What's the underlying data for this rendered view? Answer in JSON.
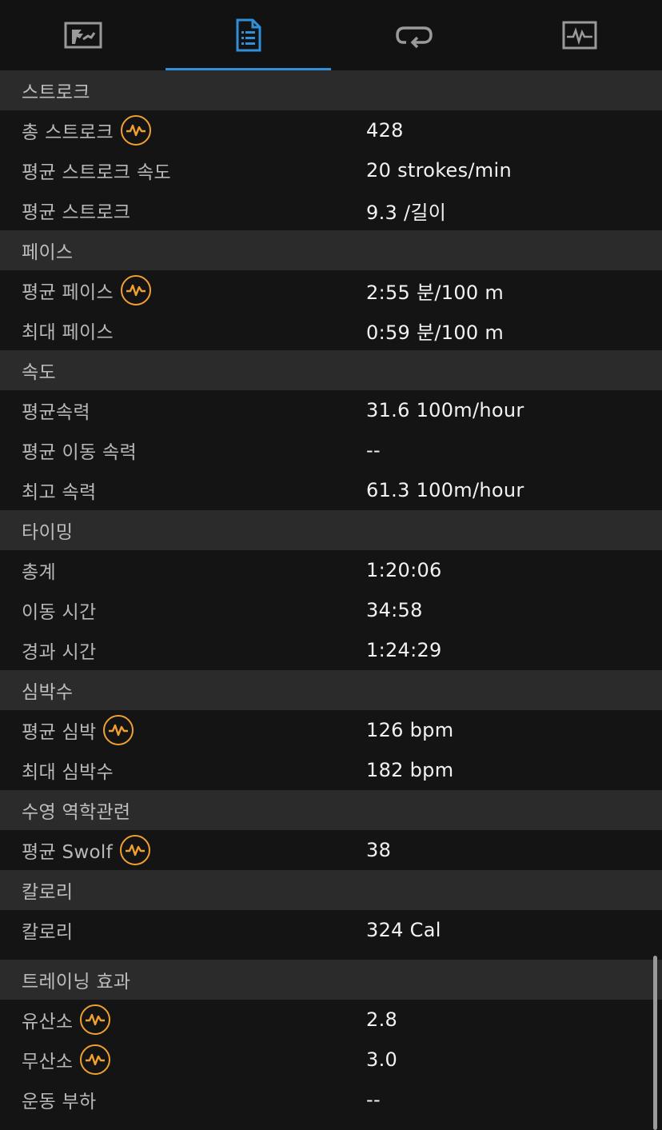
{
  "tabs": [
    {
      "icon": "summary-chart-icon",
      "active": false
    },
    {
      "icon": "stats-document-icon",
      "active": true
    },
    {
      "icon": "laps-loop-icon",
      "active": false
    },
    {
      "icon": "heart-graph-icon",
      "active": false
    }
  ],
  "colors": {
    "accent_blue": "#2f8fd8",
    "hr_orange": "#f0a030",
    "section_bg": "#2b2b2b",
    "row_bg": "#141414"
  },
  "sections": {
    "stroke": {
      "title": "스트로크",
      "rows": [
        {
          "label": "총 스트로크",
          "value": "428",
          "hr_icon": true
        },
        {
          "label": "평균 스트로크 속도",
          "value": "20 strokes/min"
        },
        {
          "label": "평균 스트로크",
          "value": "9.3 /길이"
        }
      ]
    },
    "pace": {
      "title": "페이스",
      "rows": [
        {
          "label": "평균 페이스",
          "value": "2:55 분/100 m",
          "hr_icon": true
        },
        {
          "label": "최대 페이스",
          "value": "0:59 분/100 m"
        }
      ]
    },
    "speed": {
      "title": "속도",
      "rows": [
        {
          "label": "평균속력",
          "value": "31.6 100m/hour"
        },
        {
          "label": "평균 이동 속력",
          "value": "--"
        },
        {
          "label": "최고 속력",
          "value": "61.3 100m/hour"
        }
      ]
    },
    "timing": {
      "title": "타이밍",
      "rows": [
        {
          "label": "총계",
          "value": "1:20:06"
        },
        {
          "label": "이동 시간",
          "value": "34:58"
        },
        {
          "label": "경과 시간",
          "value": "1:24:29"
        }
      ]
    },
    "heart": {
      "title": "심박수",
      "rows": [
        {
          "label": "평균 심박",
          "value": "126 bpm",
          "hr_icon": true
        },
        {
          "label": "최대 심박수",
          "value": "182 bpm"
        }
      ]
    },
    "swim": {
      "title": "수영 역학관련",
      "rows": [
        {
          "label": "평균 Swolf",
          "value": "38",
          "hr_icon": true
        }
      ]
    },
    "calories": {
      "title": "칼로리",
      "rows": [
        {
          "label": "칼로리",
          "value": "324 Cal"
        }
      ]
    },
    "training": {
      "title": "트레이닝 효과",
      "rows": [
        {
          "label": "유산소",
          "value": "2.8",
          "hr_icon": true
        },
        {
          "label": "무산소",
          "value": "3.0",
          "hr_icon": true
        },
        {
          "label": "운동 부하",
          "value": "--"
        }
      ]
    }
  }
}
